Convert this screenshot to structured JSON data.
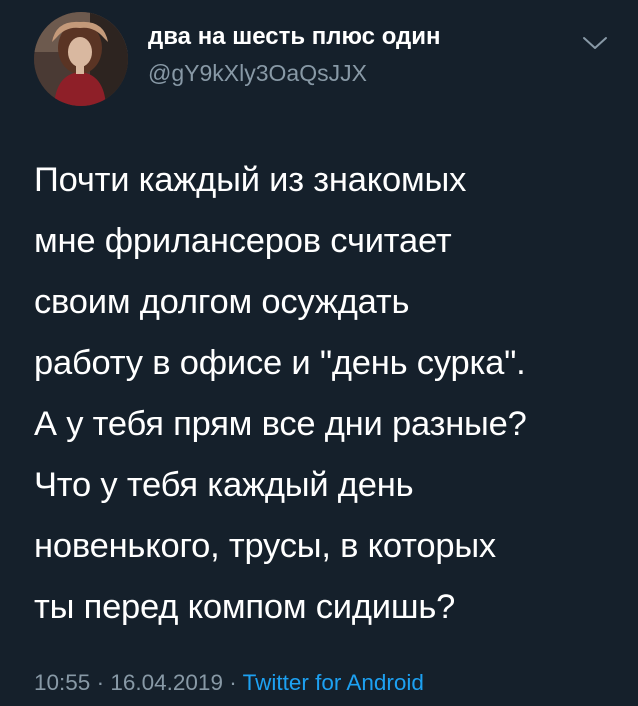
{
  "tweet": {
    "author": {
      "display_name": "два на шесть плюс один",
      "handle": "@gY9kXly3OaQsJJX",
      "avatar_icon": "profile-photo"
    },
    "menu_icon": "chevron-down-icon",
    "text": "Почти каждый из знакомых\nмне фрилансеров считает\nсвоим долгом осуждать\nработу в офисе и \"день сурка\".\nА у тебя прям все дни разные?\nЧто у тебя каждый день\nновенького, трусы, в которых\nты перед компом сидишь?",
    "time": "10:55",
    "separator": "·",
    "date": "16.04.2019",
    "source": "Twitter for Android"
  },
  "colors": {
    "background": "#15202b",
    "text": "#ffffff",
    "secondary_text": "#8899a6",
    "link": "#1da1f2"
  }
}
